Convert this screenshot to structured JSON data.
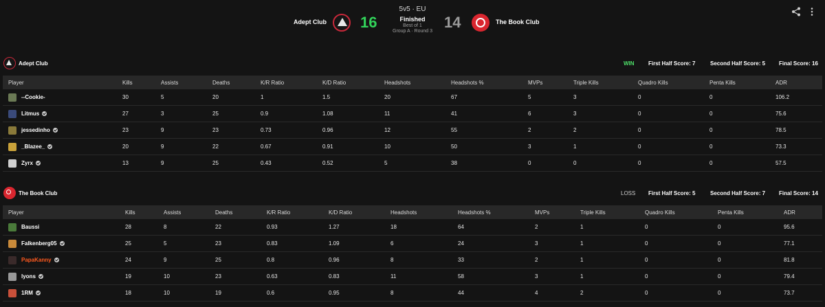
{
  "header": {
    "team_left": "Adept Club",
    "team_right": "The Book Club",
    "score_left": "16",
    "score_right": "14",
    "format": "5v5 · EU",
    "status": "Finished",
    "best_of": "Best of 1",
    "round": "Group A · Round 3"
  },
  "columns": [
    "Player",
    "Kills",
    "Assists",
    "Deaths",
    "K/R Ratio",
    "K/D Ratio",
    "Headshots",
    "Headshots %",
    "MVPs",
    "Triple Kills",
    "Quadro Kills",
    "Penta Kills",
    "ADR"
  ],
  "teams": [
    {
      "name": "Adept Club",
      "result": "WIN",
      "first_half": "First Half Score: 7",
      "second_half": "Second Half Score: 5",
      "final": "Final Score: 16",
      "players": [
        {
          "name": "--Cookie-",
          "verified": false,
          "highlight": false,
          "avatar_color": "#6b7a55",
          "stats": [
            "30",
            "5",
            "20",
            "1",
            "1.5",
            "20",
            "67",
            "5",
            "3",
            "0",
            "0",
            "106.2"
          ]
        },
        {
          "name": "Litmus",
          "verified": true,
          "highlight": false,
          "avatar_color": "#3a4a7a",
          "stats": [
            "27",
            "3",
            "25",
            "0.9",
            "1.08",
            "11",
            "41",
            "6",
            "3",
            "0",
            "0",
            "75.6"
          ]
        },
        {
          "name": "jessedinho",
          "verified": true,
          "highlight": false,
          "avatar_color": "#8a7a3a",
          "stats": [
            "23",
            "9",
            "23",
            "0.73",
            "0.96",
            "12",
            "55",
            "2",
            "2",
            "0",
            "0",
            "78.5"
          ]
        },
        {
          "name": "_Blazee_",
          "verified": true,
          "highlight": false,
          "avatar_color": "#c9a23a",
          "stats": [
            "20",
            "9",
            "22",
            "0.67",
            "0.91",
            "10",
            "50",
            "3",
            "1",
            "0",
            "0",
            "73.3"
          ]
        },
        {
          "name": "Zyrx",
          "verified": true,
          "highlight": false,
          "avatar_color": "#d0d0d0",
          "stats": [
            "13",
            "9",
            "25",
            "0.43",
            "0.52",
            "5",
            "38",
            "0",
            "0",
            "0",
            "0",
            "57.5"
          ]
        }
      ]
    },
    {
      "name": "The Book Club",
      "result": "LOSS",
      "first_half": "First Half Score: 5",
      "second_half": "Second Half Score: 7",
      "final": "Final Score: 14",
      "players": [
        {
          "name": "Baussi",
          "verified": false,
          "highlight": false,
          "avatar_color": "#4a7a3a",
          "stats": [
            "28",
            "8",
            "22",
            "0.93",
            "1.27",
            "18",
            "64",
            "2",
            "1",
            "0",
            "0",
            "95.6"
          ]
        },
        {
          "name": "Falkenberg05",
          "verified": true,
          "highlight": false,
          "avatar_color": "#c98a3a",
          "stats": [
            "25",
            "5",
            "23",
            "0.83",
            "1.09",
            "6",
            "24",
            "3",
            "1",
            "0",
            "0",
            "77.1"
          ]
        },
        {
          "name": "PapaKanny",
          "verified": true,
          "highlight": true,
          "avatar_color": "#3a2a2a",
          "stats": [
            "24",
            "9",
            "25",
            "0.8",
            "0.96",
            "8",
            "33",
            "2",
            "1",
            "0",
            "0",
            "81.8"
          ]
        },
        {
          "name": "lyons",
          "verified": true,
          "highlight": false,
          "avatar_color": "#9a9a9a",
          "stats": [
            "19",
            "10",
            "23",
            "0.63",
            "0.83",
            "11",
            "58",
            "3",
            "1",
            "0",
            "0",
            "79.4"
          ]
        },
        {
          "name": "1RM",
          "verified": true,
          "highlight": false,
          "avatar_color": "#c9503a",
          "stats": [
            "18",
            "10",
            "19",
            "0.6",
            "0.95",
            "8",
            "44",
            "4",
            "2",
            "0",
            "0",
            "73.7"
          ]
        }
      ]
    }
  ],
  "colors": {
    "win": "#4ee069",
    "score_left": "#32d35a",
    "highlight_player": "#ff5a1f"
  },
  "icons": {
    "share": "share-icon",
    "more": "more-vertical-icon"
  }
}
